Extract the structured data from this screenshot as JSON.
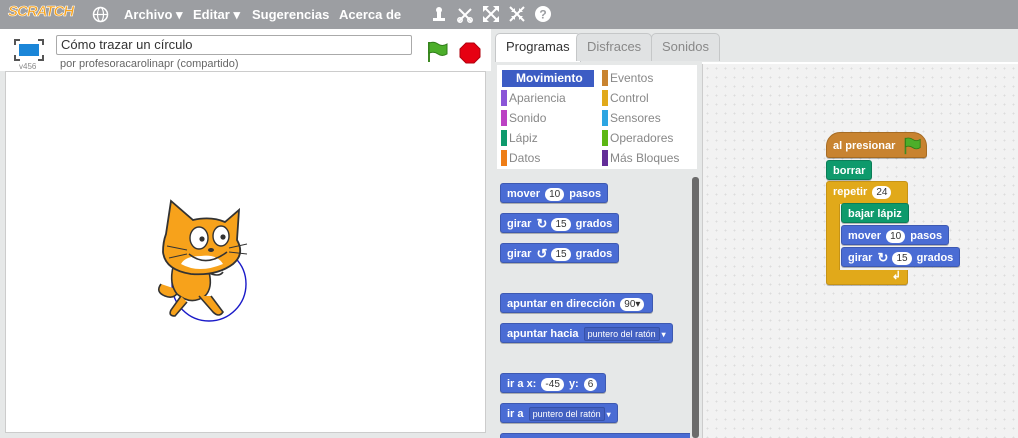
{
  "menubar": {
    "logo": "SCRATCH",
    "items": [
      "Archivo ▾",
      "Editar ▾",
      "Sugerencias",
      "Acerca de"
    ],
    "tools": [
      "duplicate-icon",
      "delete-icon",
      "grow-icon",
      "shrink-icon",
      "help-icon"
    ]
  },
  "stage": {
    "project_title": "Cómo trazar un círculo",
    "byline": "por profesoracarolinapr (compartido)",
    "version": "v456"
  },
  "tabs": [
    "Programas",
    "Disfraces",
    "Sonidos"
  ],
  "categories": {
    "left": [
      "Movimiento",
      "Apariencia",
      "Sonido",
      "Lápiz",
      "Datos"
    ],
    "right": [
      "Eventos",
      "Control",
      "Sensores",
      "Operadores",
      "Más Bloques"
    ],
    "colors_left": [
      "#4a6cd4",
      "#8a55d7",
      "#bb42c3",
      "#0e9a6c",
      "#ee7d16"
    ],
    "colors_right": [
      "#c88330",
      "#e1a91a",
      "#2ca5e2",
      "#5cb712",
      "#632d99"
    ]
  },
  "palette": {
    "move": "mover",
    "move_val": "10",
    "move_unit": "pasos",
    "turn_right": "girar",
    "turn_right_val": "15",
    "turn_right_unit": "grados",
    "turn_left": "girar",
    "turn_left_val": "15",
    "turn_left_unit": "grados",
    "point_dir": "apuntar en dirección",
    "point_dir_val": "90▾",
    "point_towards": "apuntar hacia",
    "point_towards_val": "puntero del ratón",
    "goto_xy": "ir a x:",
    "goto_x": "-45",
    "goto_y_label": "y:",
    "goto_y": "6",
    "goto": "ir a",
    "goto_val": "puntero del ratón"
  },
  "script": {
    "hat": "al presionar",
    "clear": "borrar",
    "repeat": "repetir",
    "repeat_val": "24",
    "pen_down": "bajar lápiz",
    "move": "mover",
    "move_val": "10",
    "move_unit": "pasos",
    "turn": "girar",
    "turn_val": "15",
    "turn_unit": "grados"
  }
}
